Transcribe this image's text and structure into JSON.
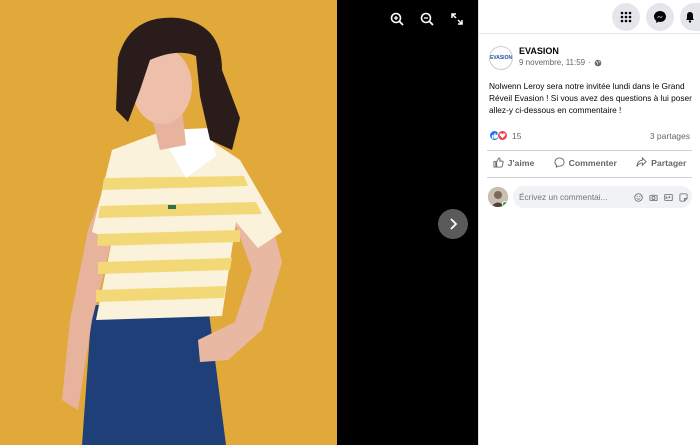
{
  "post": {
    "page_name": "EVASION",
    "page_logo_text": "EVASION",
    "date": "9 novembre, 11:59",
    "text": "Nolwenn Leroy sera notre invitée lundi dans le Grand Réveil Evasion ! Si vous avez des questions à lui poser allez-y ci-dessous en commentaire !",
    "reaction_count": "15",
    "shares": "3 partages"
  },
  "actions": {
    "like": "J'aime",
    "comment": "Commenter",
    "share": "Partager"
  },
  "comment_input": {
    "placeholder": "Écrivez un commentai..."
  },
  "colors": {
    "facebook_blue": "#1877f2",
    "photo_background": "#e0a93a",
    "shirt_stripe_yellow": "#f3d878"
  }
}
